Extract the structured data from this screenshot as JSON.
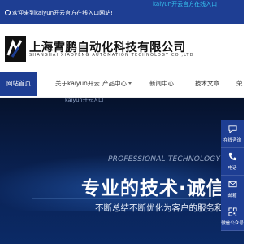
{
  "topbar": {
    "welcome": "欢迎来到kaiyun开云官方在线入口网站!",
    "portal_link": "kaiyun开云官方在线入口"
  },
  "header": {
    "logo_text": "XP",
    "company_cn": "上海霄鹏自动化科技有限公司",
    "company_en": "SHANGHAI XIAOPENG AUTOMATION TECHNOLOGY CO.,LTD"
  },
  "nav": {
    "items": [
      {
        "label": "网站首页",
        "active": true
      },
      {
        "label": "关于kaiyun开云"
      },
      {
        "label": "产品中心"
      },
      {
        "label": "新闻中心"
      },
      {
        "label": "技术文章"
      },
      {
        "label": "荣"
      }
    ],
    "dropdown_peek": "kaiyun开云入口"
  },
  "hero": {
    "tagline_en": "PROFESSIONAL TECHNOLOGY & HONEST M",
    "tagline_cn": "专业的技术·诚信",
    "tagline_sub": "不断总结不断优化为客户的服务和一"
  },
  "float_panel": {
    "items": [
      {
        "label": "在线咨询",
        "icon": "chat-icon"
      },
      {
        "label": "电话",
        "icon": "phone-icon"
      },
      {
        "label": "邮箱",
        "icon": "mail-icon"
      },
      {
        "label": "微信公众号",
        "icon": "qrcode-icon"
      }
    ]
  },
  "colors": {
    "brand": "#1e3e93",
    "link": "#37c5f2",
    "hero_bg": "#0a2254"
  }
}
